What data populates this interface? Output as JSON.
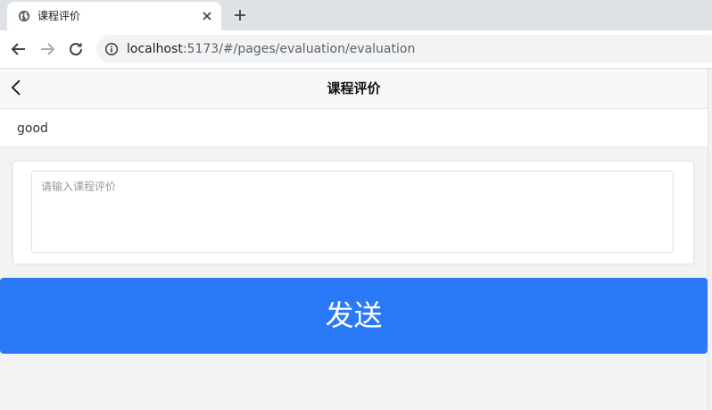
{
  "browser": {
    "tab_title": "课程评价",
    "url_host": "localhost",
    "url_path": ":5173/#/pages/evaluation/evaluation"
  },
  "page": {
    "title": "课程评价",
    "course_name": "good",
    "review_placeholder": "请输入课程评价",
    "review_value": "",
    "send_label": "发送"
  },
  "colors": {
    "accent": "#2a7af7",
    "page_background": "#f3f3f3",
    "navbar_background": "#f8f8f8"
  },
  "icons": {
    "tab": "globe-icon",
    "tab_close": "close-icon",
    "new_tab": "plus-icon",
    "back": "arrow-left-icon",
    "forward": "arrow-right-icon",
    "reload": "reload-icon",
    "site_info": "info-icon",
    "page_back": "chevron-left-icon"
  }
}
